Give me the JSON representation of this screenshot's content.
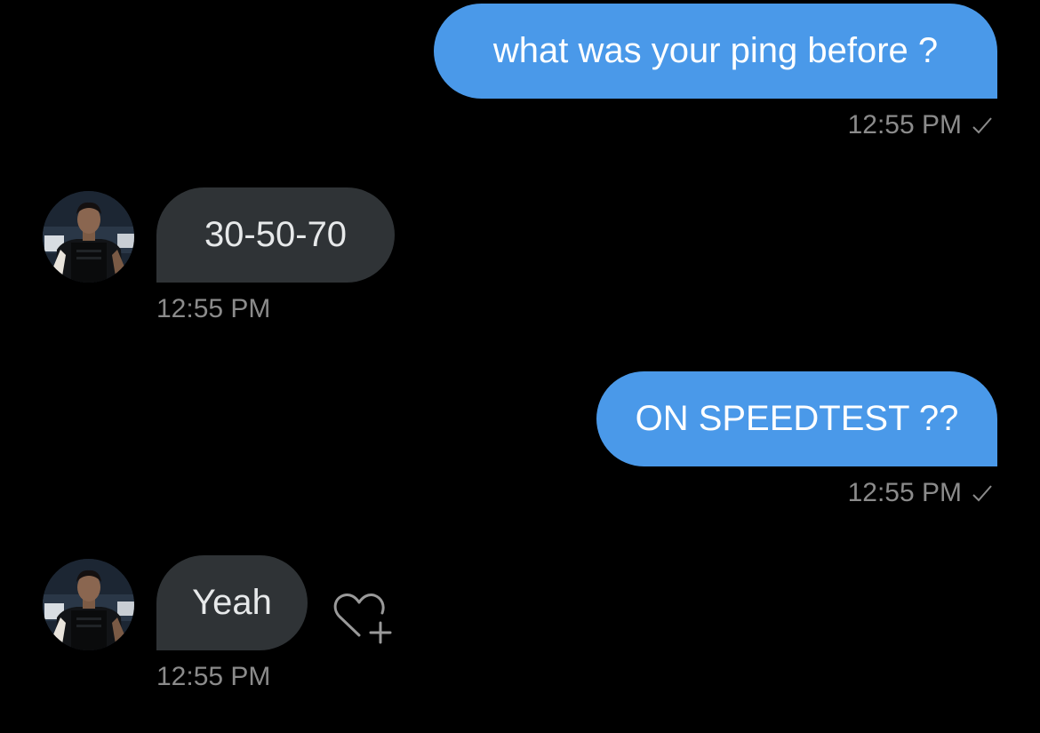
{
  "messages": [
    {
      "direction": "outgoing",
      "text": "what was your ping before ?",
      "time": "12:55 PM",
      "status_icon": "check-icon"
    },
    {
      "direction": "incoming",
      "text": "30-50-70",
      "time": "12:55 PM",
      "avatar": "contact-avatar"
    },
    {
      "direction": "outgoing",
      "text": "ON SPEEDTEST ??",
      "time": "12:55 PM",
      "status_icon": "check-icon"
    },
    {
      "direction": "incoming",
      "text": "Yeah",
      "time": "12:55 PM",
      "avatar": "contact-avatar",
      "action_icon": "add-reaction-heart-icon"
    }
  ],
  "colors": {
    "background": "#000000",
    "outgoing_bubble": "#4a99e9",
    "incoming_bubble": "#2f3336",
    "timestamp": "#8b8b8b"
  }
}
